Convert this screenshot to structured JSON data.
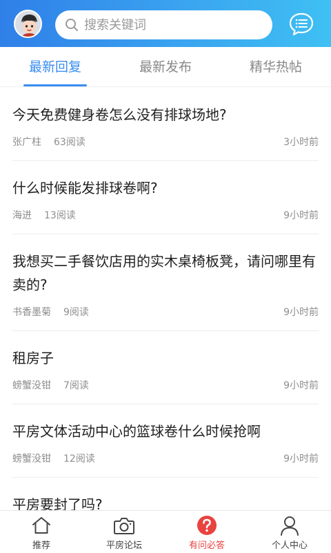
{
  "header": {
    "avatar_icon": "cartoon-avatar",
    "search_placeholder": "搜索关键词",
    "message_icon": "chat-bubble-list-icon"
  },
  "colors": {
    "header_gradient_start": "#2f7fe8",
    "header_gradient_end": "#3fc0f3",
    "active_tab": "#3a8df0",
    "active_nav": "#e8433f"
  },
  "tabs": [
    {
      "label": "最新回复",
      "active": true
    },
    {
      "label": "最新发布",
      "active": false
    },
    {
      "label": "精华热帖",
      "active": false
    }
  ],
  "posts": [
    {
      "title": "今天免费健身卷怎么没有排球场地?",
      "author": "张广柱",
      "views": "63阅读",
      "time": "3小时前"
    },
    {
      "title": "什么时候能发排球卷啊?",
      "author": "海进",
      "views": "13阅读",
      "time": "9小时前"
    },
    {
      "title": "我想买二手餐饮店用的实木桌椅板凳，请问哪里有卖的?",
      "author": "书香墨菊",
      "views": "9阅读",
      "time": "9小时前"
    },
    {
      "title": "租房子",
      "author": "螃蟹没钳",
      "views": "7阅读",
      "time": "9小时前"
    },
    {
      "title": "平房文体活动中心的篮球卷什么时候抢啊",
      "author": "螃蟹没钳",
      "views": "12阅读",
      "time": "9小时前"
    },
    {
      "title": "平房要封了吗?",
      "author": "",
      "views": "",
      "time": ""
    }
  ],
  "bottom_nav": [
    {
      "label": "推荐",
      "icon": "home-icon",
      "active": false
    },
    {
      "label": "平房论坛",
      "icon": "camera-icon",
      "active": false
    },
    {
      "label": "有问必答",
      "icon": "question-icon",
      "active": true
    },
    {
      "label": "个人中心",
      "icon": "person-icon",
      "active": false
    }
  ]
}
